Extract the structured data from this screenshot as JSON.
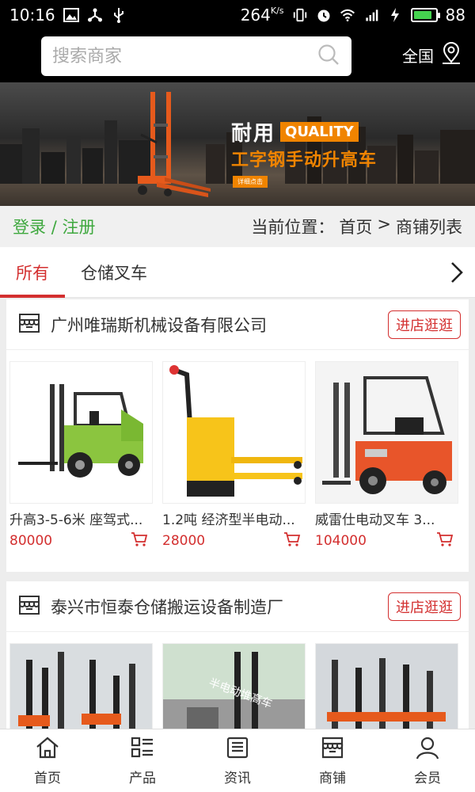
{
  "status_bar": {
    "time": "10:16",
    "speed": "264",
    "speed_unit": "K/s",
    "battery": "88",
    "battery_level": 0.88,
    "battery_color": "#44d34f"
  },
  "header": {
    "search_placeholder": "搜索商家",
    "region": "全国"
  },
  "banner": {
    "title": "耐用",
    "badge": "QUALITY",
    "subtitle": "工字钢手动升高车",
    "button": "详细点击"
  },
  "location": {
    "login": "登录",
    "separator": "/",
    "register": "注册",
    "current_label": "当前位置：",
    "home": "首页",
    "arrow": ">",
    "page": "商铺列表"
  },
  "tabs": [
    {
      "label": "所有",
      "active": true
    },
    {
      "label": "仓储叉车",
      "active": false
    }
  ],
  "shops": [
    {
      "name": "广州唯瑞斯机械设备有限公司",
      "button": "进店逛逛",
      "products": [
        {
          "name": "升高3-5-6米 座驾式...",
          "price": "80000"
        },
        {
          "name": "1.2吨 经济型半电动...",
          "price": "28000"
        },
        {
          "name": "威雷仕电动叉车 3...",
          "price": "104000"
        }
      ]
    },
    {
      "name": "泰兴市恒泰仓储搬运设备制造厂",
      "button": "进店逛逛",
      "products": [
        {
          "name": "",
          "price": ""
        },
        {
          "name": "",
          "price": "",
          "overlay": "半电动堆高车"
        },
        {
          "name": "",
          "price": ""
        }
      ]
    }
  ],
  "bottom_nav": [
    {
      "label": "首页",
      "icon": "home-icon"
    },
    {
      "label": "产品",
      "icon": "grid-list-icon"
    },
    {
      "label": "资讯",
      "icon": "news-icon"
    },
    {
      "label": "商铺",
      "icon": "store-icon"
    },
    {
      "label": "会员",
      "icon": "user-icon"
    }
  ],
  "colors": {
    "accent_red": "#d32f2f",
    "login_green": "#3ea83e",
    "banner_orange": "#f08400"
  }
}
